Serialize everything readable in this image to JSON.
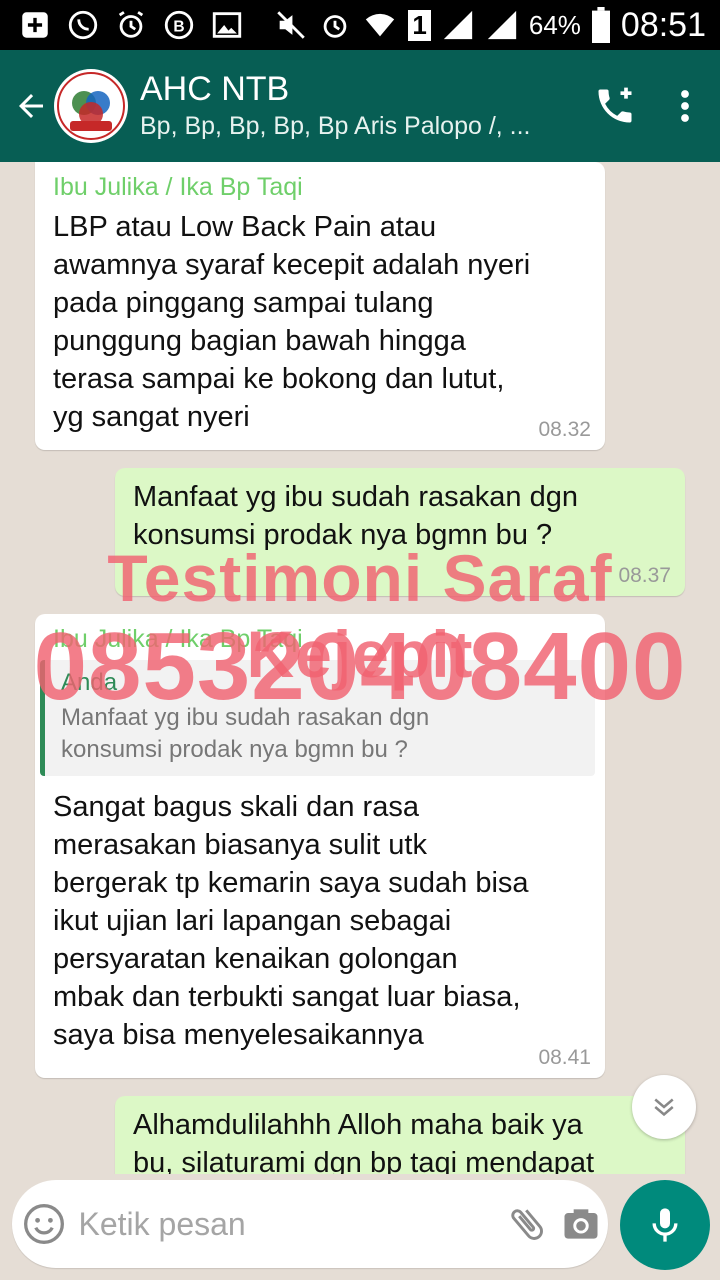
{
  "status_bar": {
    "battery_pct": "64%",
    "time": "08:51",
    "sim": "1"
  },
  "header": {
    "title": "AHC NTB",
    "subtitle": "Bp, Bp, Bp, Bp, Bp Aris Palopo /, ..."
  },
  "messages": [
    {
      "sender": "Ibu Julika / Ika Bp Taqi",
      "text": "LBP atau Low Back Pain atau\nawamnya syaraf kecepit adalah nyeri\npada pinggang sampai tulang\npunggung bagian bawah hingga\nterasa sampai ke bokong dan lutut,\nyg sangat nyeri",
      "time": "08.32"
    },
    {
      "text": "Manfaat yg ibu sudah rasakan dgn\nkonsumsi prodak nya bgmn bu ?",
      "time": "08.37"
    },
    {
      "sender": "Ibu Julika / Ika Bp Taqi",
      "quote_sender": "Anda",
      "quote_text": "Manfaat yg ibu sudah rasakan dgn\nkonsumsi prodak nya bgmn bu ?",
      "text": "Sangat bagus skali dan rasa\nmerasakan biasanya sulit utk\nbergerak tp kemarin saya sudah bisa\nikut ujian lari lapangan sebagai\npersyaratan kenaikan golongan\nmbak dan terbukti sangat luar biasa,\nsaya bisa menyelesaikannya",
      "time": "08.41"
    },
    {
      "text": "Alhamdulilahhh Alloh maha baik ya\nbu, silaturami dgn bp taqi mendapat"
    }
  ],
  "watermark": {
    "line1": "Testimoni Saraf Kejepit",
    "line2": "085320408400"
  },
  "input": {
    "placeholder": "Ketik pesan"
  },
  "colors": {
    "header": "#075e54",
    "outgoing": "#dcf8c6",
    "accent": "#008a7c",
    "watermark": "#f06270"
  }
}
